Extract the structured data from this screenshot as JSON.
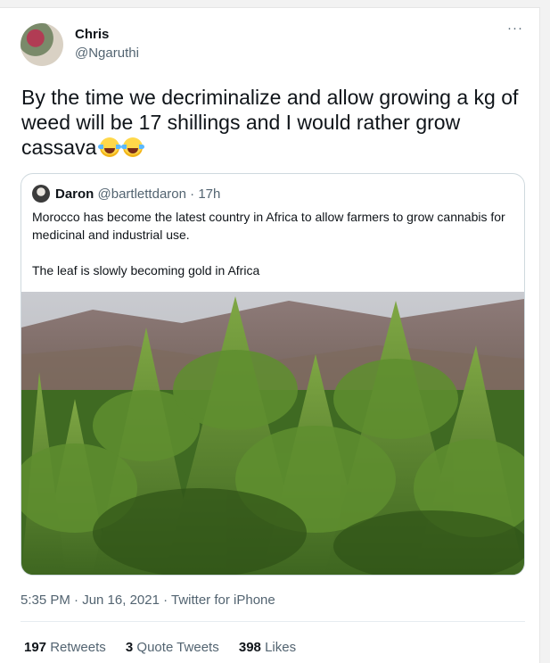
{
  "author": {
    "name": "Chris",
    "handle": "@Ngaruthi"
  },
  "more_label": "···",
  "tweet": {
    "text": "By the time we decriminalize and allow growing a kg of weed will be 17 shillings and I would rather grow cassava",
    "emoji": [
      "face-with-tears-of-joy",
      "face-with-tears-of-joy"
    ]
  },
  "quote": {
    "author_name": "Daron",
    "author_handle": "@bartlettdaron",
    "separator": " · ",
    "time": "17h",
    "paragraph1": "Morocco has become the latest country in Africa to allow farmers to grow cannabis for medicinal and industrial use.",
    "paragraph2": "The leaf is slowly becoming gold in Africa",
    "image_description": "cannabis-field-photo"
  },
  "meta": {
    "timestamp": "5:35 PM · Jun 16, 2021 · ",
    "source": "Twitter for iPhone"
  },
  "stats": {
    "retweets_count": "197",
    "retweets_label": "Retweets",
    "quotes_count": "3",
    "quotes_label": "Quote Tweets",
    "likes_count": "398",
    "likes_label": "Likes"
  },
  "colors": {
    "text": "#0f1419",
    "secondary": "#536471",
    "border": "#cfd9de"
  }
}
